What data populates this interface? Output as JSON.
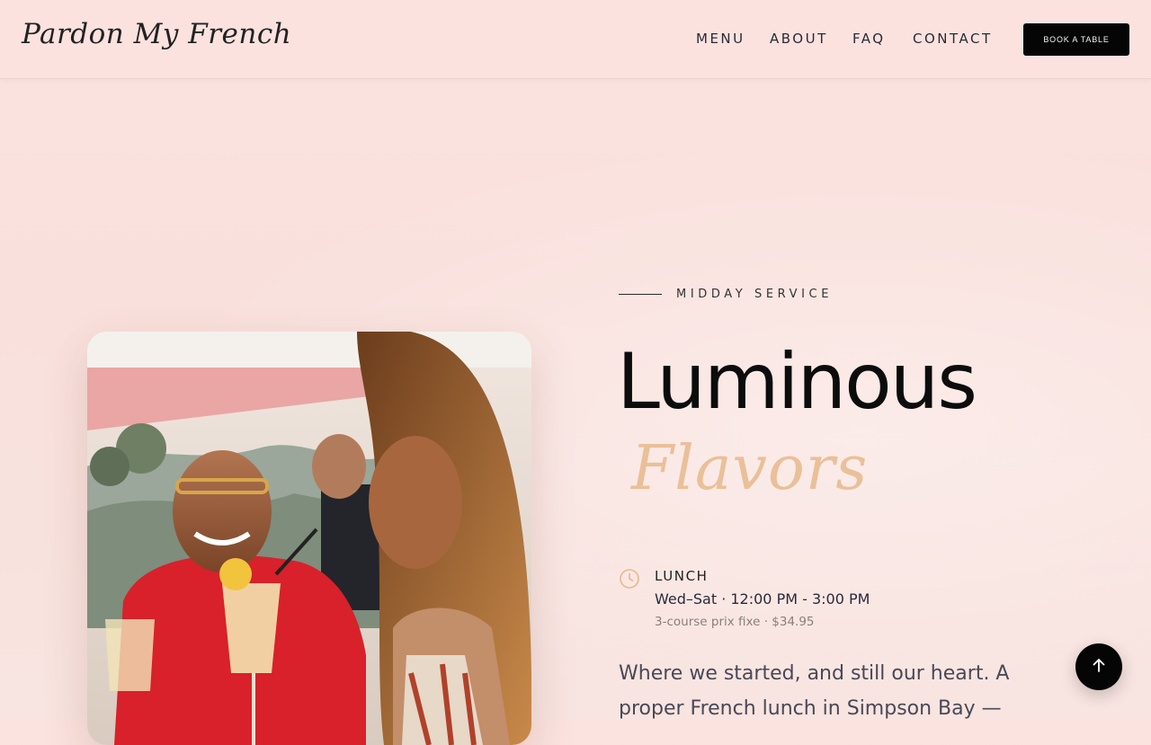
{
  "header": {
    "logo_text": "Pardon My French",
    "nav": [
      {
        "label": "MENU"
      },
      {
        "label": "ABOUT"
      },
      {
        "label": "FAQ"
      },
      {
        "label": "CONTACT"
      }
    ],
    "book_button": "BOOK A TABLE"
  },
  "hero": {
    "eyebrow": "MIDDAY SERVICE",
    "title": "Luminous",
    "title_script": "Flavors",
    "service": {
      "icon": "clock-icon",
      "label": "LUNCH",
      "hours": "Wed–Sat · 12:00 PM - 3:00 PM",
      "note": "3-course prix fixe · $34.95"
    },
    "description": "Where we started, and still our heart. A proper French lunch in Simpson Bay —"
  },
  "scroll_top": {
    "icon": "arrow-up-icon"
  },
  "colors": {
    "background": "#fbe2df",
    "accent": "#e8b98c",
    "button": "#050505"
  }
}
